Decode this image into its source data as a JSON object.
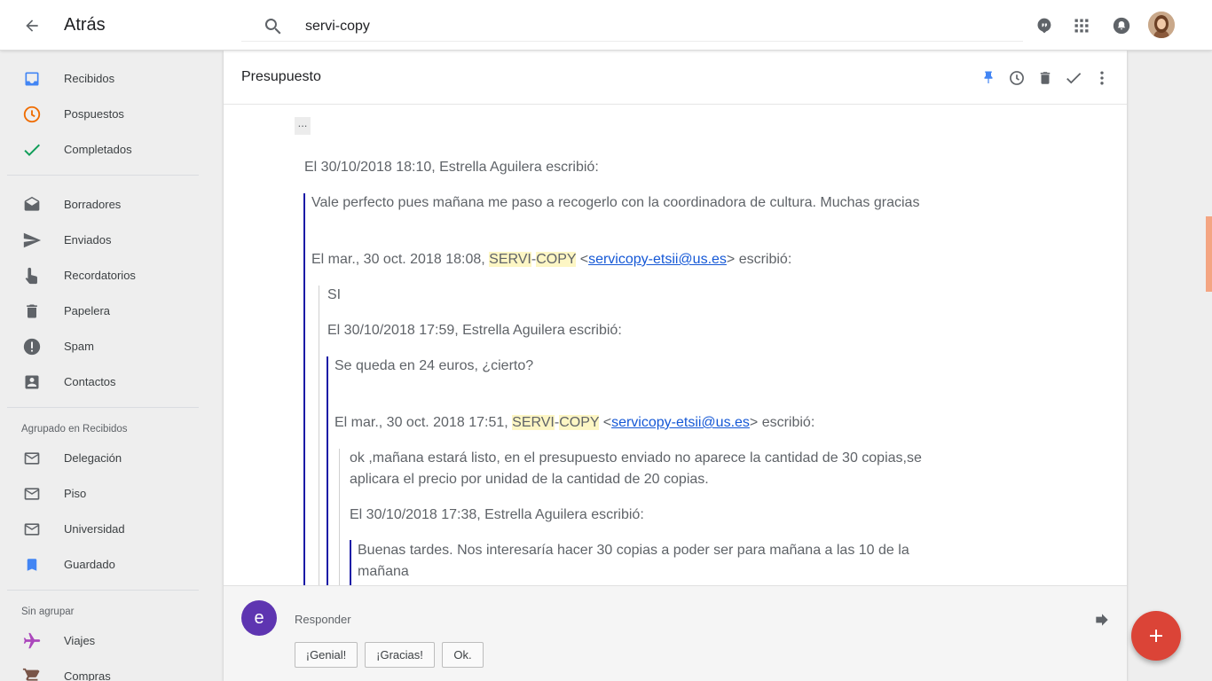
{
  "header": {
    "back_label": "Atrás",
    "search_value": "servi-copy",
    "icons": [
      "arrow-back-icon",
      "search-icon",
      "assistant-icon",
      "apps-icon",
      "notifications-icon",
      "avatar"
    ]
  },
  "sidebar": {
    "items": [
      {
        "label": "Recibidos",
        "icon": "inbox-icon"
      },
      {
        "label": "Pospuestos",
        "icon": "clock-icon"
      },
      {
        "label": "Completados",
        "icon": "check-icon"
      },
      {
        "label": "Borradores",
        "icon": "drafts-icon"
      },
      {
        "label": "Enviados",
        "icon": "send-icon"
      },
      {
        "label": "Recordatorios",
        "icon": "reminder-icon"
      },
      {
        "label": "Papelera",
        "icon": "trash-icon"
      },
      {
        "label": "Spam",
        "icon": "spam-icon"
      },
      {
        "label": "Contactos",
        "icon": "contacts-icon"
      }
    ],
    "group1_title": "Agrupado en Recibidos",
    "group1_items": [
      {
        "label": "Delegación",
        "icon": "mail-icon"
      },
      {
        "label": "Piso",
        "icon": "mail-icon"
      },
      {
        "label": "Universidad",
        "icon": "mail-icon"
      },
      {
        "label": "Guardado",
        "icon": "bookmark-icon"
      }
    ],
    "group2_title": "Sin agrupar",
    "group2_items": [
      {
        "label": "Viajes",
        "icon": "plane-icon"
      },
      {
        "label": "Compras",
        "icon": "cart-icon"
      }
    ]
  },
  "thread": {
    "subject": "Presupuesto",
    "ellipsis": "...",
    "lines": {
      "l1": "El 30/10/2018 18:10, Estrella Aguilera escribió:",
      "l2": "Vale perfecto pues mañana me paso a recogerlo con la coordinadora de cultura. Muchas gracias",
      "l3_pre": "El mar., 30 oct. 2018 18:08,",
      "servi": "SERVI",
      "dash": "-",
      "copy": "COPY",
      "lt": "<",
      "email": "servicopy-etsii@us.es",
      "gt_escribio": "> escribió:",
      "l4": "SI",
      "l5": "El 30/10/2018 17:59, Estrella Aguilera escribió:",
      "l6": "Se queda en 24 euros, ¿cierto?",
      "l7_pre": "El mar., 30 oct. 2018 17:51,",
      "l8a": "ok ,mañana estará listo, en el presupuesto enviado no aparece la cantidad de 30 copias,se",
      "l8b": "aplicara el precio por unidad de la cantidad de 20 copias.",
      "l9": "El 30/10/2018 17:38, Estrella Aguilera escribió:",
      "l10a": "Buenas tardes. Nos interesaría hacer 30 copias a poder ser para mañana a las 10 de la",
      "l10b": "mañana"
    }
  },
  "reply": {
    "avatar_letter": "e",
    "label": "Responder",
    "chips": [
      "¡Genial!",
      "¡Gracias!",
      "Ok."
    ]
  },
  "colors": {
    "accent_blue": "#4285f4",
    "snooze_orange": "#ef6c00",
    "done_green": "#0f9d58",
    "fab_red": "#db4437",
    "quote_bar": "#1a1aa6",
    "avatar_purple": "#5e35b1"
  }
}
